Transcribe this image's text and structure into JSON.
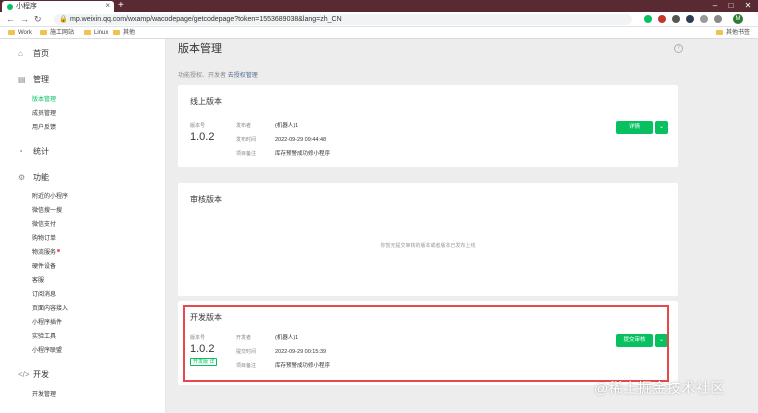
{
  "browser": {
    "tab_title": "小程序",
    "tab_close": "×",
    "new_tab": "+",
    "url": "mp.weixin.qq.com/wxamp/wacodepage/getcodepage?token=1553689038&lang=zh_CN",
    "bookmarks": [
      "Work",
      "施工网站",
      "Linux",
      "其他"
    ],
    "bookmarks_right": "其他书签",
    "avatar_letter": "M"
  },
  "sidebar": {
    "groups": [
      {
        "label": "首页",
        "icon": "home-icon"
      },
      {
        "label": "管理",
        "icon": "manage-icon"
      },
      {
        "label": "统计",
        "icon": "stats-icon"
      },
      {
        "label": "功能",
        "icon": "feature-icon"
      },
      {
        "label": "开发",
        "icon": "dev-icon"
      }
    ],
    "manage_items": [
      "版本管理",
      "成员管理",
      "用户反馈"
    ],
    "feature_items": [
      "附近的小程序",
      "微信搜一搜",
      "微信支付",
      "购物订单",
      "物流服务",
      "硬件设备",
      "客服",
      "订阅消息",
      "页面内容接入",
      "小程序插件",
      "实验工具",
      "小程序联盟"
    ],
    "dev_items": [
      "开发管理"
    ]
  },
  "main": {
    "title": "版本管理",
    "subtitle_prefix": "功能授权、开发者",
    "subtitle_link": "去授权管理",
    "online": {
      "title": "线上版本",
      "ver_label": "版本号",
      "version": "1.0.2",
      "k1": "发布者",
      "v1": "(机器人)1",
      "k2": "发布时间",
      "v2": "2022-09-29 09:44:48",
      "k3": "项目备注",
      "v3": "库存预警成功修小程序",
      "detail_btn": "详情"
    },
    "review": {
      "title": "审核版本",
      "empty": "你暂无提交审核的版本或者版本已发布上线"
    },
    "dev": {
      "title": "开发版本",
      "ver_label": "版本号",
      "version": "1.0.2",
      "badge": "开发版 详",
      "k1": "开发者",
      "v1": "(机器人)1",
      "k2": "提交时间",
      "v2": "2022-09-29 00:15:39",
      "k3": "项目备注",
      "v3": "库存预警成功修小程序",
      "submit_btn": "提交审核"
    }
  },
  "watermark": "@稀土掘金技术社区",
  "colors": {
    "accent": "#07c160",
    "highlight": "#e8474c",
    "tabbar": "#5a2a33"
  }
}
